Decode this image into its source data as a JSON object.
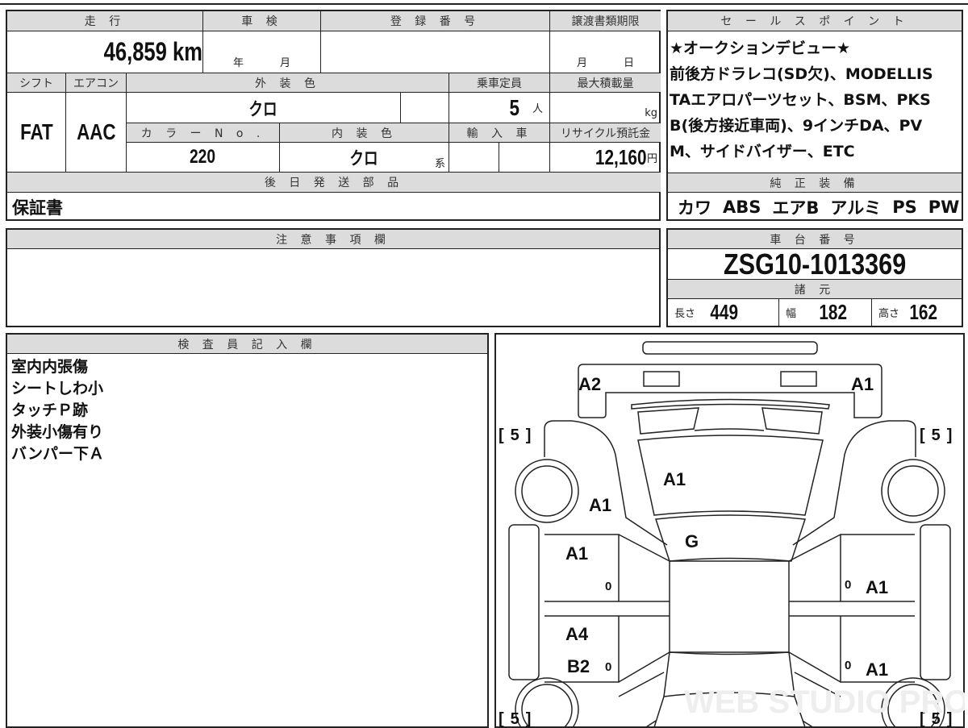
{
  "main": {
    "mileage_label": "走 行",
    "mileage": "46,859 km",
    "shaken_label": "車 検",
    "shaken_year": "年",
    "shaken_month": "月",
    "reg_label": "登 録 番 号",
    "transfer_label": "譲渡書類期限",
    "transfer_month": "月",
    "transfer_day": "日",
    "shift_label": "シフト",
    "shift": "FAT",
    "ac_label": "エアコン",
    "ac": "AAC",
    "ext_color_label": "外 装 色",
    "ext_color": "クロ",
    "capacity_label": "乗車定員",
    "capacity": "5",
    "capacity_unit": "人",
    "load_label": "最大積載量",
    "load_unit": "kg",
    "color_no_label": "カ ラ ー N o .",
    "color_no": "220",
    "int_color_label": "内 装 色",
    "int_color": "クロ",
    "int_color_suffix": "系",
    "import_label": "輸 入 車",
    "recycle_label": "リサイクル預託金",
    "recycle": "12,160",
    "recycle_unit": "円",
    "later_parts_label": "後 日 発 送 部 品",
    "later_parts": "保証書"
  },
  "notes": {
    "label": "注 意 事 項 欄"
  },
  "sales": {
    "label": "セ ー ル ス ポ イ ン ト",
    "lines": [
      "★オークションデビュー★",
      "前後方ドラレコ(SD欠)、MODELLIS",
      "TAエアロパーツセット、BSM、PKS",
      "B(後方接近車両)、9インチDA、PV",
      "M、サイドバイザー、ETC"
    ]
  },
  "equipment": {
    "label": "純 正 装 備",
    "items": [
      "カワ",
      "ABS",
      "エアB",
      "アルミ",
      "PS",
      "PW"
    ]
  },
  "chassis": {
    "label": "車 台 番 号",
    "number": "ZSG10-1013369",
    "spec_label": "諸 元",
    "length_label": "長さ",
    "length": "449",
    "width_label": "幅",
    "width": "182",
    "height_label": "高さ",
    "height": "162"
  },
  "inspector": {
    "label": "検 査 員 記 入 欄",
    "lines": [
      "室内内張傷",
      "シートしわ小",
      "タッチＰ跡",
      "外装小傷有り",
      "バンパー下Ａ"
    ]
  },
  "diagram": {
    "marks": {
      "front_left": "A2",
      "front_right": "A1",
      "hood": "A1",
      "fender_left": "A1",
      "roof_front": "G",
      "front_door_left": "A1",
      "rear_door_left_1": "A4",
      "rear_door_left_2": "B2",
      "front_door_right": "A1",
      "rear_door_right": "A1",
      "zero": "0",
      "tire": "5",
      "bracket_l": "[",
      "bracket_r": "]"
    },
    "watermark": "WEB STUDIO PRO"
  }
}
